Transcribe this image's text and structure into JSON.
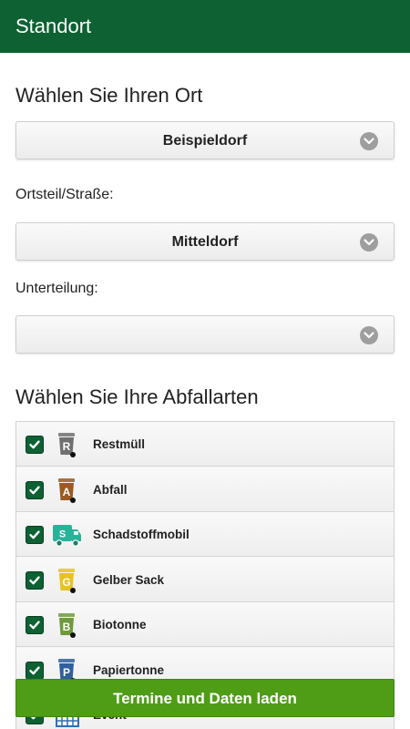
{
  "appbar": {
    "title": "Standort"
  },
  "location": {
    "heading": "Wählen Sie Ihren Ort",
    "ort": {
      "value": "Beispieldorf"
    },
    "ortsteil": {
      "label": "Ortsteil/Straße:",
      "value": "Mitteldorf"
    },
    "unterteilung": {
      "label": "Unterteilung:",
      "value": ""
    }
  },
  "waste": {
    "heading": "Wählen Sie Ihre Abfallarten",
    "items": [
      {
        "label": "Restmüll",
        "letter": "R",
        "icon": "restmuell-bin-icon",
        "color": "#707070",
        "checked": true
      },
      {
        "label": "Abfall",
        "letter": "A",
        "icon": "abfall-bin-icon",
        "color": "#9a5a22",
        "checked": true
      },
      {
        "label": "Schadstoffmobil",
        "letter": "S",
        "icon": "truck-icon",
        "color": "#29b29a",
        "checked": true
      },
      {
        "label": "Gelber Sack",
        "letter": "G",
        "icon": "gelber-sack-bin-icon",
        "color": "#e6c31e",
        "checked": true
      },
      {
        "label": "Biotonne",
        "letter": "B",
        "icon": "biotonne-bin-icon",
        "color": "#6f9a3c",
        "checked": true
      },
      {
        "label": "Papiertonne",
        "letter": "P",
        "icon": "papiertonne-bin-icon",
        "color": "#2f5f9e",
        "checked": true
      },
      {
        "label": "Event",
        "letter": "",
        "icon": "calendar-icon",
        "color": "#2f6fb5",
        "checked": true
      }
    ]
  },
  "cta": {
    "label": "Termine und Daten laden"
  },
  "colors": {
    "primary": "#0d6132",
    "cta": "#4f9d17"
  }
}
